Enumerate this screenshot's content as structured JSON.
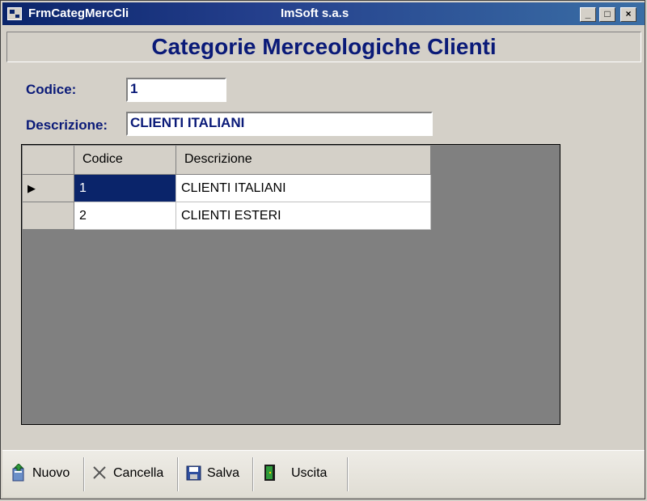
{
  "window": {
    "title": "FrmCategMercCli",
    "company": "ImSoft s.a.s",
    "buttons": {
      "minimize": "_",
      "maximize": "□",
      "close": "×"
    }
  },
  "header": {
    "title": "Categorie Merceologiche Clienti"
  },
  "form": {
    "codice_label": "Codice:",
    "codice_value": "1",
    "descrizione_label": "Descrizione:",
    "descrizione_value": "CLIENTI ITALIANI"
  },
  "grid": {
    "columns": [
      "Codice",
      "Descrizione"
    ],
    "row_indicator": "▶",
    "rows": [
      {
        "codice": "1",
        "descrizione": "CLIENTI ITALIANI",
        "selected": true
      },
      {
        "codice": "2",
        "descrizione": "CLIENTI ESTERI",
        "selected": false
      }
    ]
  },
  "toolbar": {
    "nuovo": "Nuovo",
    "cancella": "Cancella",
    "salva": "Salva",
    "uscita": "Uscita",
    "icons": {
      "nuovo": "new-document-icon",
      "cancella": "delete-x-icon",
      "salva": "save-disk-icon",
      "uscita": "exit-door-icon"
    }
  }
}
